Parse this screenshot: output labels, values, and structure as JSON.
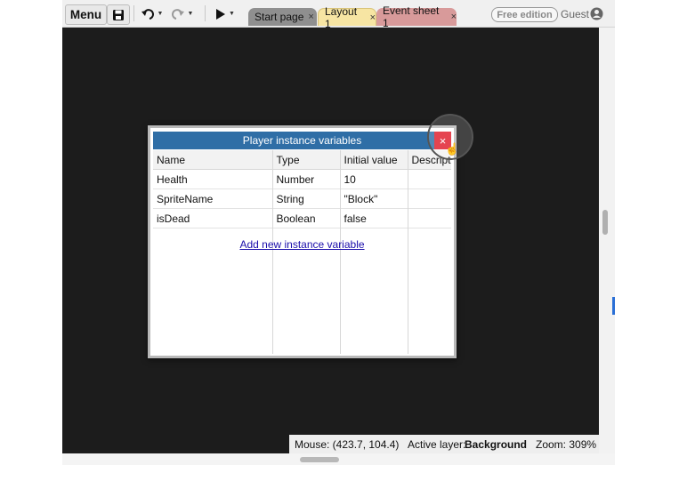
{
  "toolbar": {
    "menu_label": "Menu",
    "save_icon": "floppy-disk-icon",
    "undo_icon": "undo-icon",
    "redo_icon": "redo-icon",
    "play_icon": "play-icon"
  },
  "tabs": [
    {
      "label": "Start page",
      "color": "#8f8f8f"
    },
    {
      "label": "Layout 1",
      "color": "#f7e5a3"
    },
    {
      "label": "Event sheet 1",
      "color": "#d89a9a"
    }
  ],
  "tab_close_glyph": "×",
  "edition_badge": "Free edition",
  "user_label": "Guest",
  "dialog": {
    "title": "Player instance variables",
    "close_glyph": "×",
    "columns": [
      "Name",
      "Type",
      "Initial value",
      "Descript"
    ],
    "rows": [
      {
        "name": "Health",
        "type": "Number",
        "initial": "10",
        "description": ""
      },
      {
        "name": "SpriteName",
        "type": "String",
        "initial": "\"Block\"",
        "description": ""
      },
      {
        "name": "isDead",
        "type": "Boolean",
        "initial": "false",
        "description": ""
      }
    ],
    "add_link": "Add new instance variable"
  },
  "status_bar": {
    "mouse": "Mouse: (423.7, 104.4)",
    "active_layer_label": "Active layer:",
    "active_layer_value": "Background",
    "zoom": "Zoom: 309%"
  },
  "colors": {
    "title_bar": "#2f6ea6",
    "close_button": "#e01b2a",
    "canvas": "#1c1c1c",
    "sprite": "#6fd98f"
  }
}
